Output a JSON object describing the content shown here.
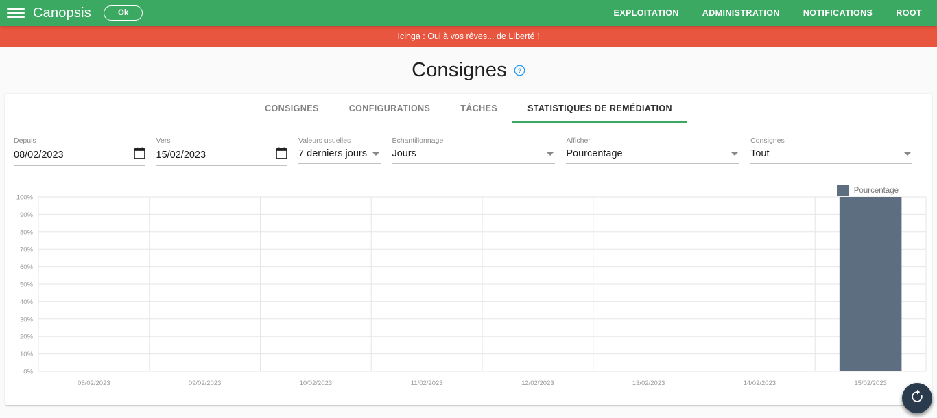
{
  "appbar": {
    "menu_icon": "hamburger-icon",
    "brand": "Canopsis",
    "status_badge": "Ok",
    "nav": [
      {
        "label": "EXPLOITATION"
      },
      {
        "label": "ADMINISTRATION"
      },
      {
        "label": "NOTIFICATIONS"
      },
      {
        "label": "ROOT"
      }
    ]
  },
  "banner": {
    "text": "Icinga : Oui à vos rêves... de Liberté !",
    "color": "#e8563f"
  },
  "page": {
    "title": "Consignes",
    "help_icon": "help-circle-icon",
    "help_color": "#2196f3"
  },
  "tabs": [
    {
      "label": "CONSIGNES",
      "active": false
    },
    {
      "label": "CONFIGURATIONS",
      "active": false
    },
    {
      "label": "TÂCHES",
      "active": false
    },
    {
      "label": "STATISTIQUES DE REMÉDIATION",
      "active": true
    }
  ],
  "filters": {
    "from": {
      "label": "Depuis",
      "value": "08/02/2023",
      "icon": "calendar-icon"
    },
    "to": {
      "label": "Vers",
      "value": "15/02/2023",
      "icon": "calendar-icon"
    },
    "usual": {
      "label": "Valeurs usuelles",
      "value": "7 derniers jours",
      "icon": "chevron-down-icon"
    },
    "sample": {
      "label": "Échantillonnage",
      "value": "Jours",
      "icon": "chevron-down-icon"
    },
    "display": {
      "label": "Afficher",
      "value": "Pourcentage",
      "icon": "chevron-down-icon"
    },
    "scope": {
      "label": "Consignes",
      "value": "Tout",
      "icon": "chevron-down-icon"
    }
  },
  "fab": {
    "icon": "refresh-icon",
    "color": "#2a3b4d"
  },
  "accent": {
    "green": "#3ca963",
    "bar": "#5d6e80",
    "grid": "#e6e6e6"
  },
  "chart_data": {
    "type": "bar",
    "title": "",
    "xlabel": "",
    "ylabel": "",
    "categories": [
      "08/02/2023",
      "09/02/2023",
      "10/02/2023",
      "11/02/2023",
      "12/02/2023",
      "13/02/2023",
      "14/02/2023",
      "15/02/2023"
    ],
    "values": [
      0,
      0,
      0,
      0,
      0,
      0,
      0,
      100
    ],
    "series": [
      {
        "name": "Pourcentage",
        "color": "#5d6e80",
        "values": [
          0,
          0,
          0,
          0,
          0,
          0,
          0,
          100
        ]
      }
    ],
    "ylim": [
      0,
      100
    ],
    "ytick_labels": [
      "100%",
      "90%",
      "80%",
      "70%",
      "60%",
      "50%",
      "40%",
      "30%",
      "20%",
      "10%",
      "0%"
    ],
    "ytick_values": [
      100,
      90,
      80,
      70,
      60,
      50,
      40,
      30,
      20,
      10,
      0
    ],
    "grid": true,
    "legend_position": "top-right",
    "legend": [
      {
        "label": "Pourcentage",
        "color": "#5d6e80"
      }
    ]
  }
}
